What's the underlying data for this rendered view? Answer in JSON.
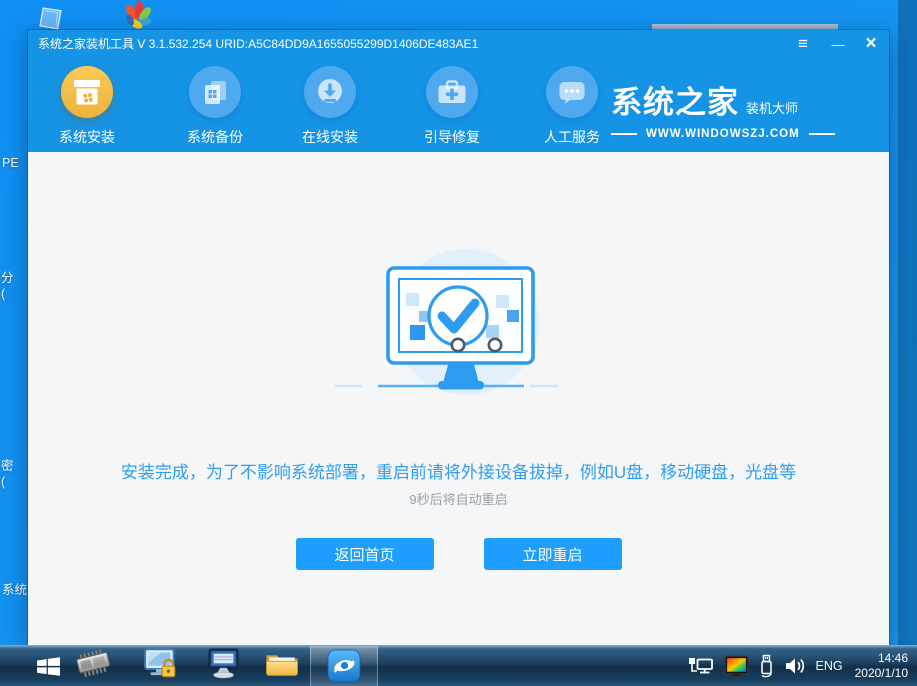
{
  "desktop": {
    "cut_labels": {
      "pe": "PE",
      "fen": "分\n(",
      "mi": "密\n(",
      "xitong": "系统"
    },
    "icons": [
      "glass-monitor-icon",
      "flower-gallery-icon"
    ]
  },
  "window": {
    "title": "系统之家装机工具 V 3.1.532.254 URID:A5C84DD9A1655055299D1406DE483AE1",
    "controls": {
      "menu": "≡",
      "minimize": "—",
      "close": "×"
    },
    "nav": {
      "items": [
        {
          "label": "系统安装",
          "icon": "install-box-icon",
          "active": true
        },
        {
          "label": "系统备份",
          "icon": "backup-copies-icon",
          "active": false
        },
        {
          "label": "在线安装",
          "icon": "online-download-icon",
          "active": false
        },
        {
          "label": "引导修复",
          "icon": "boot-repair-toolbox-icon",
          "active": false
        },
        {
          "label": "人工服务",
          "icon": "support-chat-icon",
          "active": false
        }
      ]
    },
    "logo": {
      "title": "系统之家",
      "subtitle": "装机大师",
      "url": "WWW.WINDOWSZJ.COM"
    },
    "main": {
      "message": "安装完成，为了不影响系统部署，重启前请将外接设备拔掉，例如U盘，移动硬盘，光盘等",
      "countdown": "9秒后将自动重启",
      "back_button": "返回首页",
      "restart_button": "立即重启",
      "status_icon": "monitor-check-success-icon"
    }
  },
  "taskbar": {
    "icons": [
      "start-button",
      "memory-chip-icon",
      "lock-screen-monitor-icon",
      "on-screen-keyboard-icon",
      "file-explorer-folder-icon",
      "installer-app-icon"
    ],
    "tray": {
      "language": "ENG",
      "time": "14:46",
      "date": "2020/1/10",
      "icons": [
        "network-icon",
        "display-color-icon",
        "usb-eject-icon",
        "volume-icon"
      ]
    }
  },
  "colors": {
    "desktop_blue": "#1190f2",
    "header_blue": "#1594e6",
    "accent_blue": "#1e9fff",
    "active_gold": "#f0bb45",
    "message_blue": "#2f9df5",
    "countdown_gray": "#9aa0a6",
    "content_bg": "#f4f6f8"
  }
}
